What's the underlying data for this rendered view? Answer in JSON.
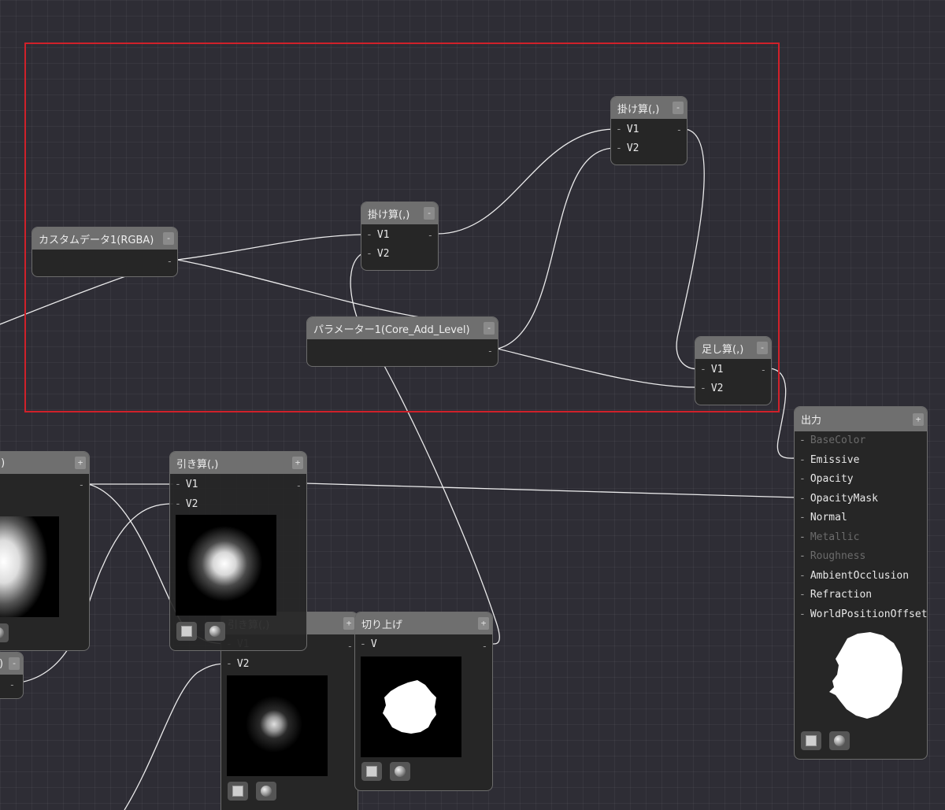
{
  "nodes": {
    "custom_data": {
      "title": "カスタムデータ1(RGBA)",
      "toggle": "-",
      "out": "-"
    },
    "multiply_1": {
      "title": "掛け算(,)",
      "toggle": "-",
      "inputs": [
        "V1",
        "V2"
      ],
      "out": "-"
    },
    "multiply_2": {
      "title": "掛け算(,)",
      "toggle": "-",
      "inputs": [
        "V1",
        "V2"
      ],
      "out": "-"
    },
    "parameter": {
      "title": "パラメーター1(Core_Add_Level)",
      "toggle": "-",
      "out": "-"
    },
    "add": {
      "title": "足し算(,)",
      "toggle": "-",
      "inputs": [
        "V1",
        "V2"
      ],
      "out": "-"
    },
    "left_partial": {
      "title": ",)",
      "toggle": "+",
      "out": "-"
    },
    "left_small": {
      "title": ")",
      "toggle": "-",
      "out": "-"
    },
    "subtract_1": {
      "title": "引き算(,)",
      "toggle": "+",
      "inputs": [
        "V1",
        "V2"
      ],
      "out": "-"
    },
    "subtract_2": {
      "title": "引き算(,)",
      "toggle": "+",
      "inputs": [
        "V1",
        "V2"
      ],
      "out": "-"
    },
    "ceil": {
      "title": "切り上げ",
      "toggle": "+",
      "inputs": [
        "V"
      ],
      "out": "-"
    },
    "output": {
      "title": "出力",
      "toggle": "+",
      "pins": [
        {
          "label": "BaseColor",
          "enabled": false
        },
        {
          "label": "Emissive",
          "enabled": true
        },
        {
          "label": "Opacity",
          "enabled": true
        },
        {
          "label": "OpacityMask",
          "enabled": true
        },
        {
          "label": "Normal",
          "enabled": true
        },
        {
          "label": "Metallic",
          "enabled": false
        },
        {
          "label": "Roughness",
          "enabled": false
        },
        {
          "label": "AmbientOcclusion",
          "enabled": true
        },
        {
          "label": "Refraction",
          "enabled": true
        },
        {
          "label": "WorldPositionOffset",
          "enabled": true
        }
      ]
    }
  },
  "pin_dash": "-",
  "colors": {
    "background": "#2e2d35",
    "selection": "#d0212a",
    "node_header": "#6f6f6f",
    "node_body": "#262626",
    "wire": "#ffffff"
  }
}
